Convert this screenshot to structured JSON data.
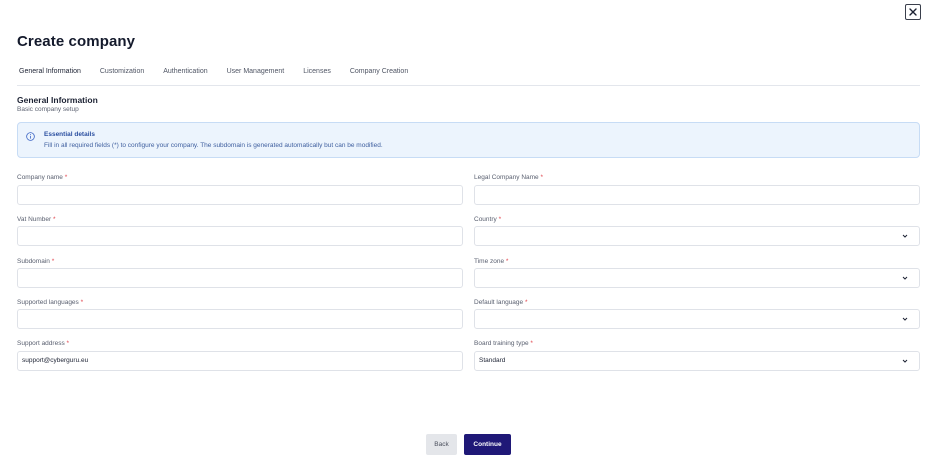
{
  "header": {
    "title": "Create company",
    "close_icon": "close-icon"
  },
  "tabs": [
    {
      "label": "General Information",
      "active": true
    },
    {
      "label": "Customization",
      "active": false
    },
    {
      "label": "Authentication",
      "active": false
    },
    {
      "label": "User Management",
      "active": false
    },
    {
      "label": "Licenses",
      "active": false
    },
    {
      "label": "Company Creation",
      "active": false
    }
  ],
  "section": {
    "title": "General Information",
    "subtitle": "Basic company setup"
  },
  "alert": {
    "icon": "info-icon",
    "title": "Essential details",
    "text": "Fill in all required fields (*) to configure your company. The subdomain is generated automatically but can be modified."
  },
  "form": {
    "company_name": {
      "label": "Company name",
      "required": "*",
      "value": ""
    },
    "legal_company_name": {
      "label": "Legal Company Name",
      "required": "*",
      "value": ""
    },
    "vat_number": {
      "label": "Vat Number",
      "required": "*",
      "value": ""
    },
    "country": {
      "label": "Country",
      "required": "*",
      "value": ""
    },
    "subdomain": {
      "label": "Subdomain",
      "required": "*",
      "value": ""
    },
    "time_zone": {
      "label": "Time zone",
      "required": "*",
      "value": ""
    },
    "supported_languages": {
      "label": "Supported languages",
      "required": "*",
      "value": ""
    },
    "default_language": {
      "label": "Default language",
      "required": "*",
      "value": ""
    },
    "support_address": {
      "label": "Support address",
      "required": "*",
      "value": "support@cyberguru.eu"
    },
    "board_training_type": {
      "label": "Board training type",
      "required": "*",
      "value": "Standard"
    }
  },
  "footer": {
    "back_label": "Back",
    "continue_label": "Continue"
  },
  "colors": {
    "primary": "#1f1877",
    "required": "#e1434b",
    "alert_bg": "#ecf4fd",
    "alert_text": "#2b4fa0"
  }
}
